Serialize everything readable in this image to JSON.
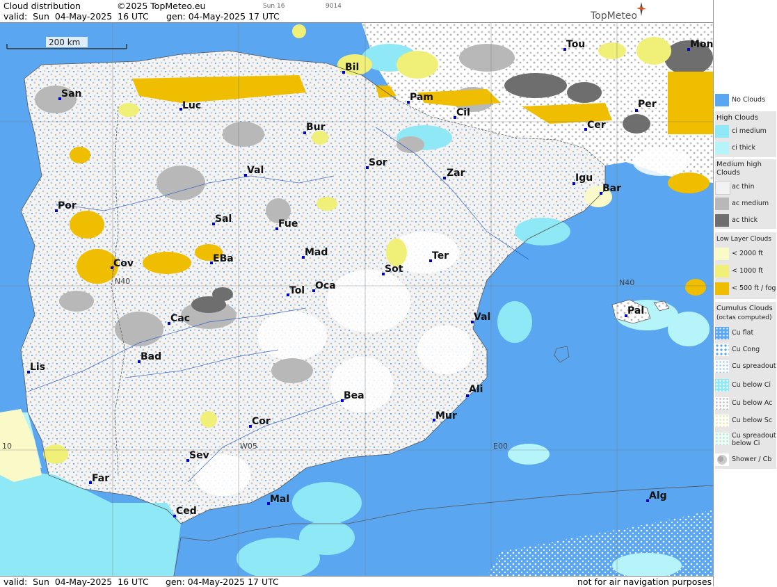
{
  "header": {
    "title": "Cloud distribution",
    "copyright": "©2025 TopMeteo.eu",
    "valid": "valid:  Sun  04-May-2025  16 UTC",
    "gen": "gen: 04-May-2025 17 UTC",
    "small1": "Sun 16",
    "small2": "9014",
    "brand": "TopMeteo"
  },
  "map": {
    "scale_label": "200 km",
    "grid_labels": [
      "N40",
      "N40",
      "W05",
      "E00",
      "10"
    ],
    "cities": [
      "Tou",
      "Mon",
      "Bil",
      "San",
      "Luc",
      "Pam",
      "Cil",
      "Per",
      "Cer",
      "Bur",
      "Sor",
      "Zar",
      "Val",
      "Igu",
      "Bar",
      "Por",
      "Sal",
      "Fue",
      "Mad",
      "Cov",
      "EBa",
      "Sot",
      "Ter",
      "Tol",
      "Oca",
      "Pal",
      "Cac",
      "Val",
      "Bad",
      "Lis",
      "Bea",
      "Ali",
      "Mur",
      "Cor",
      "Sev",
      "Far",
      "Ced",
      "Mal",
      "Alg"
    ]
  },
  "footer": {
    "valid": "valid:  Sun  04-May-2025  16 UTC",
    "gen": "gen: 04-May-2025 17 UTC",
    "note": "not for air navigation purposes"
  },
  "legend": {
    "no_clouds": "No Clouds",
    "high": {
      "title": "High Clouds",
      "items": [
        "ci medium",
        "ci thick"
      ]
    },
    "medium": {
      "title": "Medium high Clouds",
      "items": [
        "ac thin",
        "ac medium",
        "ac thick"
      ]
    },
    "low": {
      "title": "Low Layer Clouds",
      "items": [
        "< 2000 ft",
        "< 1000 ft",
        "< 500 ft / fog"
      ]
    },
    "cumulus": {
      "title": "Cumulus Clouds",
      "subtitle": "(octas computed)",
      "items": [
        "Cu flat",
        "Cu Cong",
        "Cu spreadout",
        "Cu below Ci",
        "Cu below Ac",
        "Cu below Sc",
        "Cu spreadout below Ci",
        "Shower / Cb"
      ]
    }
  },
  "colors": {
    "no_clouds": "#5aa6f0",
    "ci_medium": "#8ee8f5",
    "ci_thick": "#b5f5fa",
    "ac_thin": "#f2f2f2",
    "ac_medium": "#b8b8b8",
    "ac_thick": "#6e6e6e",
    "low_2000": "#fafac8",
    "low_1000": "#f0f078",
    "low_500": "#f0be00"
  }
}
